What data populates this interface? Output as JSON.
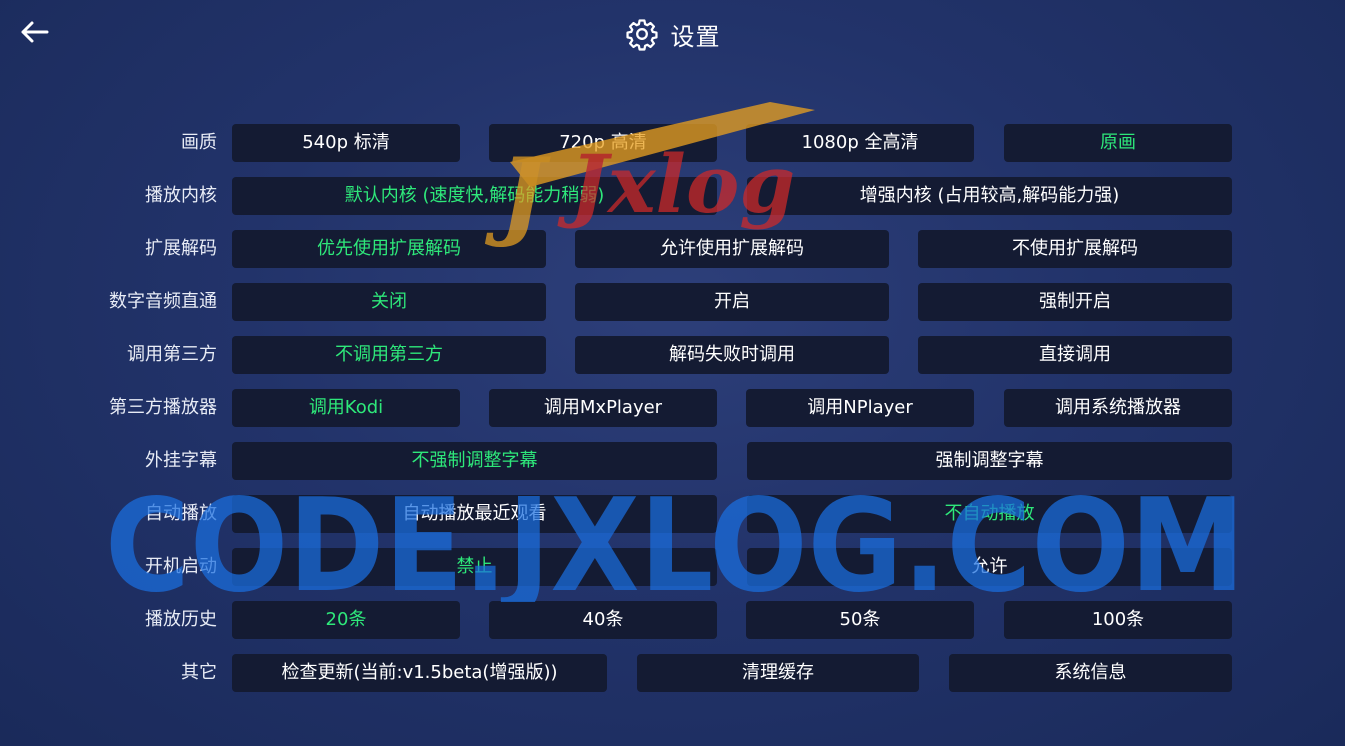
{
  "header": {
    "title": "设置",
    "back_icon": "arrow-left-icon",
    "settings_icon": "gear-icon"
  },
  "colors": {
    "selected": "#2ee87a",
    "button_bg": "#141b33",
    "background": "#22336a"
  },
  "rows": [
    {
      "key": "quality",
      "label": "画质",
      "options": [
        {
          "label": "540p 标清",
          "selected": false
        },
        {
          "label": "720p 高清",
          "selected": false
        },
        {
          "label": "1080p 全高清",
          "selected": false
        },
        {
          "label": "原画",
          "selected": true
        }
      ]
    },
    {
      "key": "player-core",
      "label": "播放内核",
      "options": [
        {
          "label": "默认内核 (速度快,解码能力稍弱)",
          "selected": true
        },
        {
          "label": "增强内核 (占用较高,解码能力强)",
          "selected": false
        }
      ]
    },
    {
      "key": "ext-decode",
      "label": "扩展解码",
      "options": [
        {
          "label": "优先使用扩展解码",
          "selected": true
        },
        {
          "label": "允许使用扩展解码",
          "selected": false
        },
        {
          "label": "不使用扩展解码",
          "selected": false
        }
      ]
    },
    {
      "key": "audio-passthrough",
      "label": "数字音频直通",
      "options": [
        {
          "label": "关闭",
          "selected": true
        },
        {
          "label": "开启",
          "selected": false
        },
        {
          "label": "强制开启",
          "selected": false
        }
      ]
    },
    {
      "key": "third-party-call",
      "label": "调用第三方",
      "options": [
        {
          "label": "不调用第三方",
          "selected": true
        },
        {
          "label": "解码失败时调用",
          "selected": false
        },
        {
          "label": "直接调用",
          "selected": false
        }
      ]
    },
    {
      "key": "third-party-player",
      "label": "第三方播放器",
      "options": [
        {
          "label": "调用Kodi",
          "selected": true
        },
        {
          "label": "调用MxPlayer",
          "selected": false
        },
        {
          "label": "调用NPlayer",
          "selected": false
        },
        {
          "label": "调用系统播放器",
          "selected": false
        }
      ]
    },
    {
      "key": "external-subtitle",
      "label": "外挂字幕",
      "options": [
        {
          "label": "不强制调整字幕",
          "selected": true
        },
        {
          "label": "强制调整字幕",
          "selected": false
        }
      ]
    },
    {
      "key": "autoplay",
      "label": "自动播放",
      "options": [
        {
          "label": "自动播放最近观看",
          "selected": false
        },
        {
          "label": "不自动播放",
          "selected": true
        }
      ]
    },
    {
      "key": "boot-start",
      "label": "开机启动",
      "options": [
        {
          "label": "禁止",
          "selected": true
        },
        {
          "label": "允许",
          "selected": false
        }
      ]
    },
    {
      "key": "play-history",
      "label": "播放历史",
      "options": [
        {
          "label": "20条",
          "selected": true
        },
        {
          "label": "40条",
          "selected": false
        },
        {
          "label": "50条",
          "selected": false
        },
        {
          "label": "100条",
          "selected": false
        }
      ]
    },
    {
      "key": "other",
      "label": "其它",
      "options": [
        {
          "label": "检查更新(当前:v1.5beta(增强版))",
          "selected": false
        },
        {
          "label": "清理缓存",
          "selected": false
        },
        {
          "label": "系统信息",
          "selected": false
        }
      ]
    }
  ],
  "watermarks": {
    "top": "Jxlog",
    "bottom": "CODE.JXLOG.COM"
  }
}
